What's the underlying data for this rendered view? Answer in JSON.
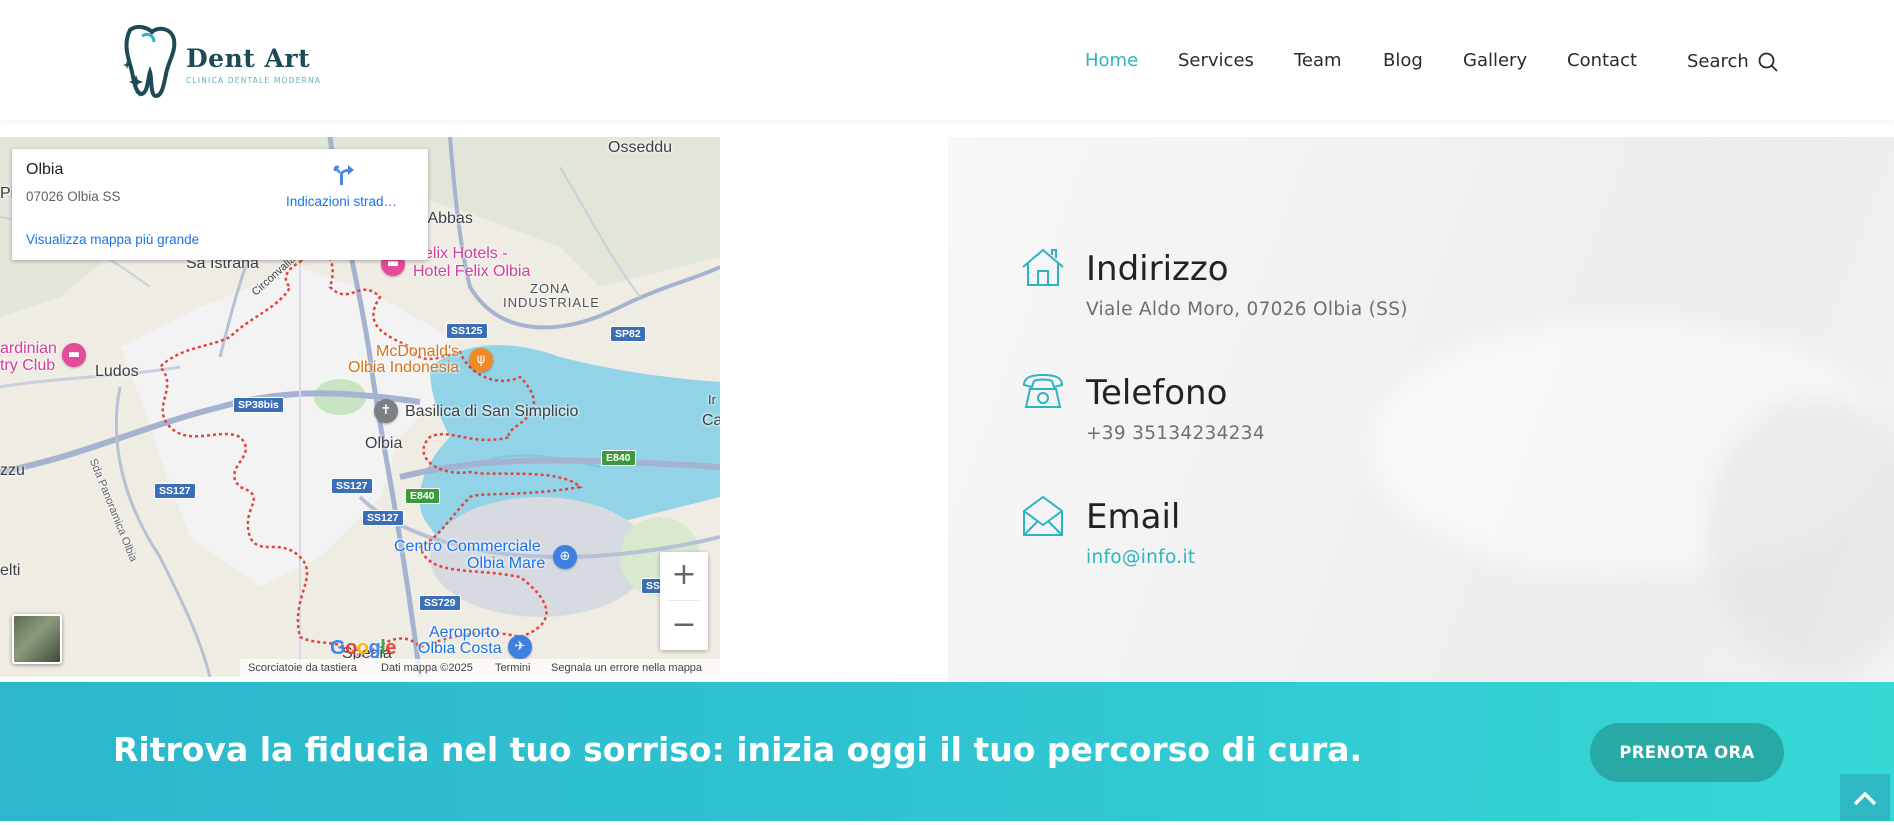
{
  "header": {
    "logo_title": "Dent Art",
    "logo_subtitle": "CLINICA DENTALE MODERNA",
    "nav": [
      {
        "label": "Home",
        "active": true
      },
      {
        "label": "Services",
        "active": false
      },
      {
        "label": "Team",
        "active": false
      },
      {
        "label": "Blog",
        "active": false
      },
      {
        "label": "Gallery",
        "active": false
      },
      {
        "label": "Contact",
        "active": false
      }
    ],
    "search_label": "Search"
  },
  "map": {
    "card": {
      "title": "Olbia",
      "address": "07026 Olbia SS",
      "directions_label": "Indicazioni strad…",
      "larger_map_link": "Visualizza mappa più grande"
    },
    "labels": {
      "osseddu": "Osseddu",
      "abbas": "u Abbas",
      "sa_istrana": "Sa Istrana",
      "circonvallazione": "Circonvallazio",
      "felix": "elix Hotels -",
      "felix2": "Hotel Felix Olbia",
      "zona": "ZONA",
      "industriale": "INDUSTRIALE",
      "sardinian": "ardinian",
      "try_club": "try Club",
      "ludos": "Ludos",
      "mcdonalds": "McDonald's",
      "mcdonalds2": "Olbia Indonesia",
      "basilica": "Basilica di San Simplicio",
      "olbia": "Olbia",
      "panoramica": "Sda Panoramica Olbia",
      "zzu": "zzu",
      "elti": "elti",
      "centro": "Centro Commerciale",
      "centro2": "Olbia Mare",
      "aeroporto": "Aeroporto",
      "aeroporto2": "Olbia Costa",
      "spedia": "Spedia",
      "pi": "Pi",
      "ca": "Ca",
      "ir": "Ir"
    },
    "shields": {
      "ss125": "SS125",
      "sp82": "SP82",
      "sp38bis": "SP38bis",
      "ss127a": "SS127",
      "ss127b": "SS127",
      "ss127c": "SS127",
      "e840a": "E840",
      "e840b": "E840",
      "ss729": "SS729",
      "ss1": "SS"
    },
    "zoom_in": "+",
    "zoom_out": "−",
    "google": "Google",
    "attribution": {
      "shortcuts": "Scorciatoie da tastiera",
      "data": "Dati mappa ©2025",
      "terms": "Termini",
      "report": "Segnala un errore nella mappa"
    }
  },
  "contact": {
    "items": [
      {
        "icon": "house-icon",
        "title": "Indirizzo",
        "value": "Viale Aldo Moro, 07026 Olbia (SS)"
      },
      {
        "icon": "phone-icon",
        "title": "Telefono",
        "value": "+39 35134234234"
      },
      {
        "icon": "envelope-icon",
        "title": "Email",
        "value": "info@info.it"
      }
    ]
  },
  "banner": {
    "text": "Ritrova la fiducia nel tuo sorriso: inizia oggi il tuo percorso di cura.",
    "cta": "PRENOTA ORA"
  },
  "colors": {
    "accent": "#2bb5c1",
    "brand_dark": "#1c4a55",
    "cta": "#28a9a3",
    "banner_start": "#2cb7cc",
    "banner_end": "#36d8d6"
  }
}
